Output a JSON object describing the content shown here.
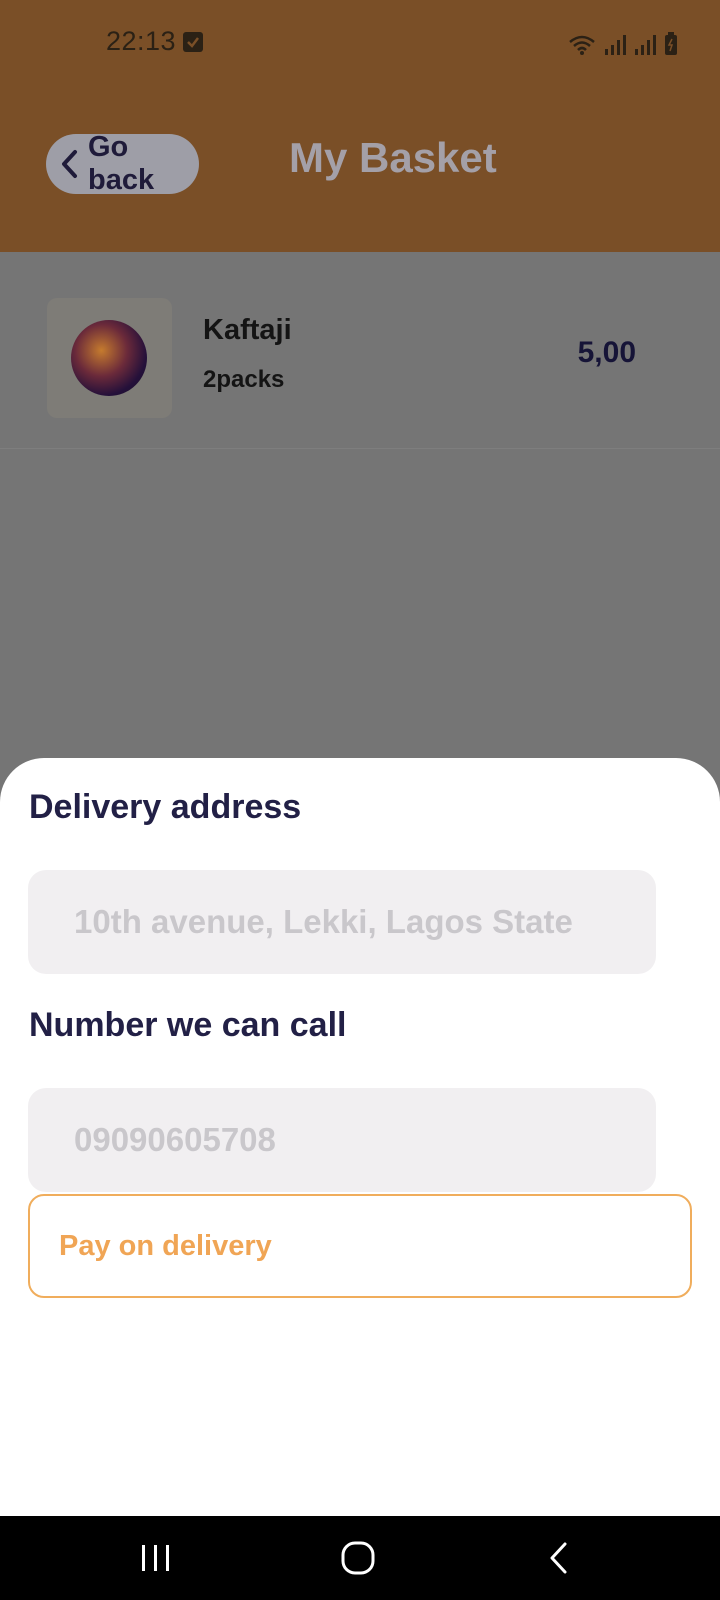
{
  "status_bar": {
    "time": "22:13"
  },
  "header": {
    "back_label": "Go back",
    "title": "My Basket",
    "color": "#7a4f27"
  },
  "basket": {
    "items": [
      {
        "name": "Kaftaji",
        "quantity": "2packs",
        "price": "5,00"
      }
    ]
  },
  "sheet": {
    "address_label": "Delivery address",
    "address_placeholder": "10th avenue, Lekki, Lagos State",
    "phone_label": "Number we can call",
    "phone_placeholder": "09090605708",
    "pay_button_label": "Pay on delivery",
    "accent_color": "#f0a555"
  },
  "nav": {
    "icons": [
      "recent-apps-icon",
      "home-icon",
      "back-icon"
    ]
  }
}
